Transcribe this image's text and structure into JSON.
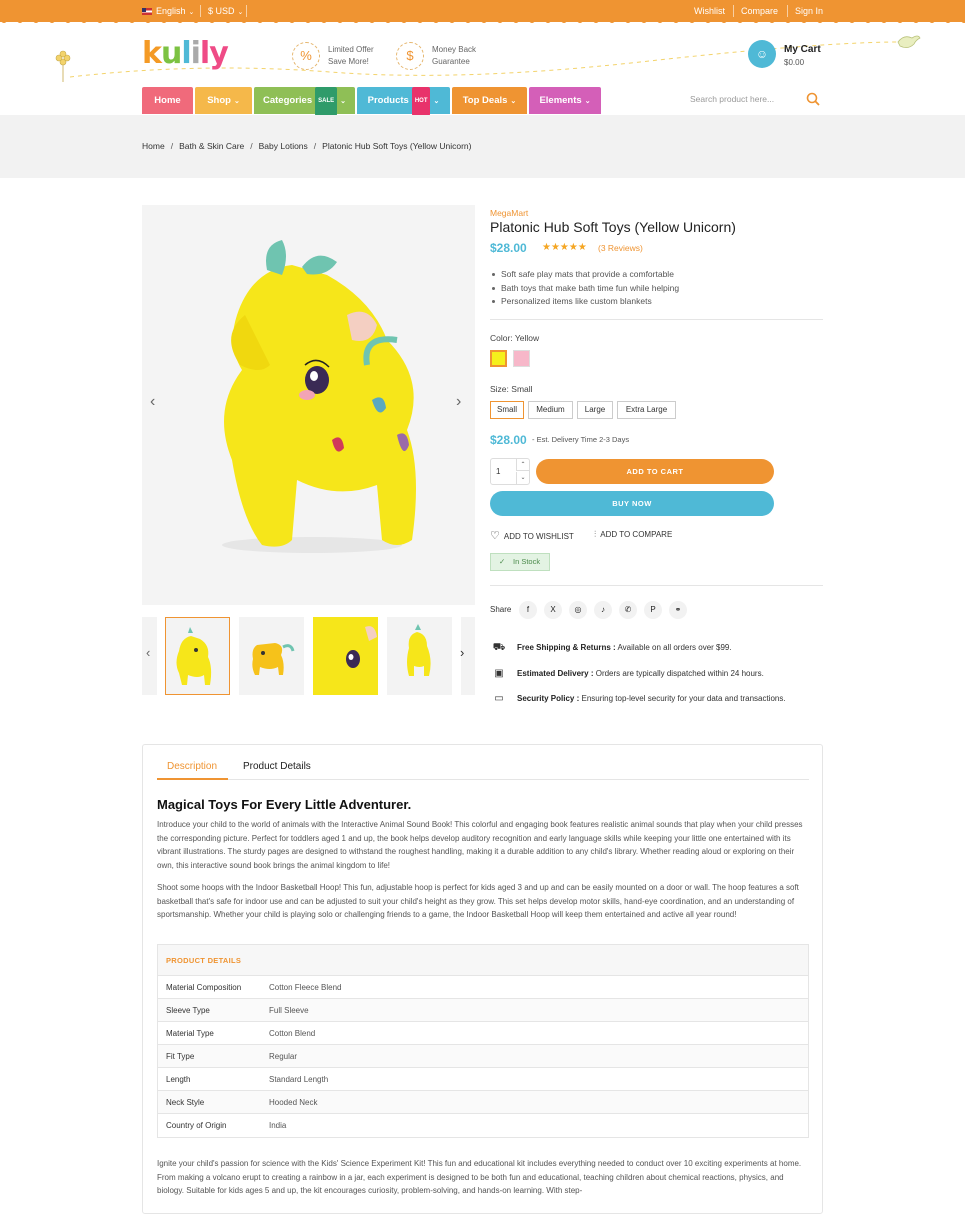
{
  "topbar": {
    "language": "English",
    "currency": "$ USD",
    "links": [
      "Wishlist",
      "Compare",
      "Sign In"
    ]
  },
  "header": {
    "logo": [
      "k",
      "u",
      "l",
      "i",
      "ly"
    ],
    "promos": [
      {
        "line1": "Limited Offer",
        "line2": "Save More!",
        "icon": "percent-icon"
      },
      {
        "line1": "Money Back",
        "line2": "Guarantee",
        "icon": "money-bag-icon"
      }
    ],
    "cart": {
      "title": "My Cart",
      "amount": "$0.00",
      "icon": "cart-bag-icon"
    }
  },
  "nav": {
    "items": [
      {
        "label": "Home",
        "color": "#f06a7b"
      },
      {
        "label": "Shop",
        "color": "#f5b84a"
      },
      {
        "label": "Categories",
        "badge": "SALE",
        "badge_color": "#2f9b6a",
        "color": "#8fbf56"
      },
      {
        "label": "Products",
        "badge": "HOT",
        "badge_color": "#e8336b",
        "color": "#4fb9d6"
      },
      {
        "label": "Top Deals",
        "color": "#ef9432"
      },
      {
        "label": "Elements",
        "color": "#d45fb8"
      }
    ],
    "search_placeholder": "Search product here..."
  },
  "breadcrumb": [
    "Home",
    "Bath & Skin Care",
    "Baby Lotions",
    "Platonic Hub Soft Toys (Yellow Unicorn)"
  ],
  "product": {
    "brand": "MegaMart",
    "title": "Platonic Hub Soft Toys (Yellow Unicorn)",
    "price": "$28.00",
    "rating": 5,
    "reviews": "(3 Reviews)",
    "bullets": [
      "Soft safe play mats that provide a comfortable",
      "Bath toys that make bath time fun while helping",
      "Personalized items like custom blankets"
    ],
    "color_label": "Color:",
    "color_value": "Yellow",
    "swatches": [
      "#f5f01c",
      "#f7b7c9"
    ],
    "size_label": "Size:",
    "size_value": "Small",
    "sizes": [
      "Small",
      "Medium",
      "Large",
      "Extra Large"
    ],
    "price2": "$28.00",
    "delivery": "- Est. Delivery Time 2-3 Days",
    "quantity": "1",
    "add_to_cart": "ADD TO CART",
    "buy_now": "BUY NOW",
    "wishlist": "ADD TO WISHLIST",
    "compare": "ADD TO COMPARE",
    "stock": "In Stock",
    "share_label": "Share",
    "social": [
      "f",
      "X",
      "◎",
      "♪",
      "✆",
      "P",
      "⚭"
    ],
    "services": [
      {
        "title": "Free Shipping & Returns :",
        "text": "Available on all orders over $99.",
        "icon": "truck-icon"
      },
      {
        "title": "Estimated Delivery :",
        "text": "Orders are typically dispatched within 24 hours.",
        "icon": "delivery-box-icon"
      },
      {
        "title": "Security Policy :",
        "text": "Ensuring top-level security for your data and transactions.",
        "icon": "card-lock-icon"
      }
    ]
  },
  "description": {
    "tabs": [
      "Description",
      "Product Details"
    ],
    "heading": "Magical Toys For Every Little Adventurer.",
    "p1": "Introduce your child to the world of animals with the Interactive Animal Sound Book! This colorful and engaging book features realistic animal sounds that play when your child presses the corresponding picture. Perfect for toddlers aged 1 and up, the book helps develop auditory recognition and early language skills while keeping your little one entertained with its vibrant illustrations. The sturdy pages are designed to withstand the roughest handling, making it a durable addition to any child's library. Whether reading aloud or exploring on their own, this interactive sound book brings the animal kingdom to life!",
    "p2": "Shoot some hoops with the Indoor Basketball Hoop! This fun, adjustable hoop is perfect for kids aged 3 and up and can be easily mounted on a door or wall. The hoop features a soft basketball that's safe for indoor use and can be adjusted to suit your child's height as they grow. This set helps develop motor skills, hand-eye coordination, and an understanding of sportsmanship. Whether your child is playing solo or challenging friends to a game, the Indoor Basketball Hoop will keep them entertained and active all year round!",
    "table_title": "PRODUCT DETAILS",
    "rows": [
      {
        "k": "Material Composition",
        "v": "Cotton Fleece Blend"
      },
      {
        "k": "Sleeve Type",
        "v": "Full Sleeve"
      },
      {
        "k": "Material Type",
        "v": "Cotton Blend"
      },
      {
        "k": "Fit Type",
        "v": "Regular"
      },
      {
        "k": "Length",
        "v": "Standard Length"
      },
      {
        "k": "Neck Style",
        "v": "Hooded Neck"
      },
      {
        "k": "Country of Origin",
        "v": "India"
      }
    ],
    "p3": "Ignite your child's passion for science with the Kids' Science Experiment Kit! This fun and educational kit includes everything needed to conduct over 10 exciting experiments at home. From making a volcano erupt to creating a rainbow in a jar, each experiment is designed to be both fun and educational, teaching children about chemical reactions, physics, and biology. Suitable for kids ages 5 and up, the kit encourages curiosity, problem-solving, and hands-on learning. With step-"
  }
}
